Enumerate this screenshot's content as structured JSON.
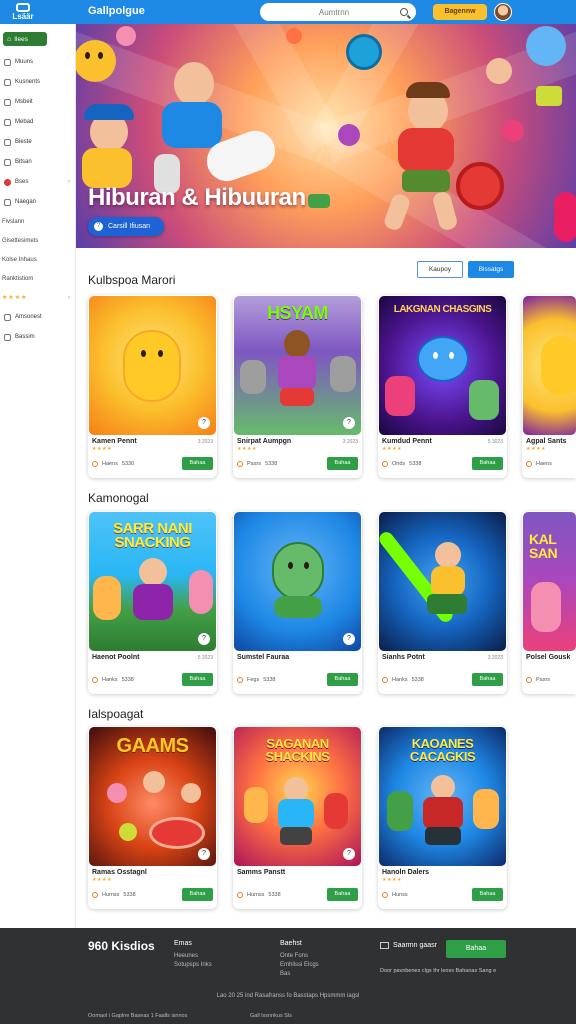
{
  "header": {
    "logo_text": "Lsäär",
    "brand": "Gallpolgue",
    "search_placeholder": "Aumtrnn",
    "cta_label": "Bagennw",
    "colors": {
      "bar": "#1e88e5",
      "cta": "#fbc02d"
    }
  },
  "sidebar": {
    "home_label": "Ilees",
    "items": [
      {
        "label": "Muuns",
        "icon": "gamepad-icon"
      },
      {
        "label": "Kusnents",
        "icon": "grid-icon"
      },
      {
        "label": "Msbeit",
        "icon": "puzzle-icon"
      },
      {
        "label": "Mebad",
        "icon": "cube-icon"
      },
      {
        "label": "Bieste",
        "icon": "shield-icon"
      },
      {
        "label": "Bitsan",
        "icon": "car-icon"
      },
      {
        "label": "Bses",
        "icon": "badge-icon"
      },
      {
        "label": "Naegan",
        "icon": "heart-icon"
      }
    ],
    "plain_items": [
      "Fivslann",
      "Gisettesimets",
      "Kolse Inhaus",
      "Ranktistiom"
    ],
    "rating_label": "★★★★",
    "bottom_items": [
      {
        "label": "Amsonest",
        "icon": "settings-icon"
      },
      {
        "label": "Bassim",
        "icon": "box-icon"
      }
    ]
  },
  "hero": {
    "title": "Hiburan & Hibuuran",
    "button_label": "Carsill Ifiusan"
  },
  "sections": [
    {
      "title": "Kulbspoa Marori",
      "tabs": [
        "Kaupoy",
        "Bissatgs"
      ],
      "cards": [
        {
          "title": "Kamen Pennt",
          "meta": "3 2023",
          "stars": "★★★★",
          "foot1": "Haens",
          "foot2": "5330",
          "btn": "Bahaa"
        },
        {
          "title": "Snirpat Aumpgn",
          "meta": "3 2023",
          "stars": "★★★★",
          "foot1": "Pasrs",
          "foot2": "5338",
          "btn": "Bahaa"
        },
        {
          "title": "Kumdud Pennt",
          "meta": "5 3023",
          "stars": "★★★★",
          "foot1": "Onds",
          "foot2": "5338",
          "btn": "Bahaa"
        },
        {
          "title": "Agpal Sants",
          "meta": "3 2023",
          "stars": "★★★★",
          "foot1": "Haens",
          "foot2": "",
          "btn": ""
        }
      ]
    },
    {
      "title": "Kamonogal",
      "cards": [
        {
          "title": "Haenot Poolnt",
          "meta": "5 2023",
          "stars": "",
          "foot1": "Hanks",
          "foot2": "5338",
          "btn": "Bahaa"
        },
        {
          "title": "Sumstel Fauraa",
          "meta": "",
          "stars": "",
          "foot1": "Fegs",
          "foot2": "5338",
          "btn": "Bahaa"
        },
        {
          "title": "Sianhs Potnt",
          "meta": "3 2023",
          "stars": "",
          "foot1": "Hanks",
          "foot2": "5338",
          "btn": "Bahaa"
        },
        {
          "title": "Polsel Gousk",
          "meta": "",
          "stars": "",
          "foot1": "Pasrs",
          "foot2": "",
          "btn": ""
        }
      ]
    },
    {
      "title": "Ialspoagat",
      "cards": [
        {
          "title": "Ramas Osstagnl",
          "meta": "",
          "stars": "★★★★",
          "foot1": "Hurnss",
          "foot2": "5338",
          "btn": "Bahaa"
        },
        {
          "title": "Samms Panstt",
          "meta": "",
          "stars": "",
          "foot1": "Hurnss",
          "foot2": "5338",
          "btn": "Bahaa"
        },
        {
          "title": "Hanoln Dalers",
          "meta": "",
          "stars": "★★★★",
          "foot1": "Hunss",
          "foot2": "",
          "btn": "Bahaa"
        }
      ]
    }
  ],
  "thumb_texts": {
    "s1c2": "HSYAM",
    "s1c3": "LAKGNAN CHASGINS",
    "s2c1": "SARR NANI SNACKING",
    "s2c4": "KAL SAN",
    "s3c1": "GAAMS",
    "s3c2": "SAGANAN SHACKINS",
    "s3c3": "KAOANES CACAGKIS"
  },
  "footer": {
    "logo": "960 Kisdios",
    "col1_title": "Emas",
    "col1_items": [
      "Heeunes",
      "Sotupsps Inks"
    ],
    "col2_title": "Baehst",
    "col2_items": [
      "Onte Fons",
      "Emhlissi Elcgs",
      "Bas"
    ],
    "subscribe_label": "Saarmn gaasr",
    "subscribe_btn": "Bahaa",
    "note": "Door pavnbenes clgs thr leoss Bahanas Sang e",
    "copyright": "Lao 20 25 ind Rasafranss fo Basstaps Hpsmmm iagsl",
    "legal1": "Oomaol i Gaplne Baseas 1 Faalls isnnos",
    "legal2": "Gall lssnnkus Sls"
  }
}
